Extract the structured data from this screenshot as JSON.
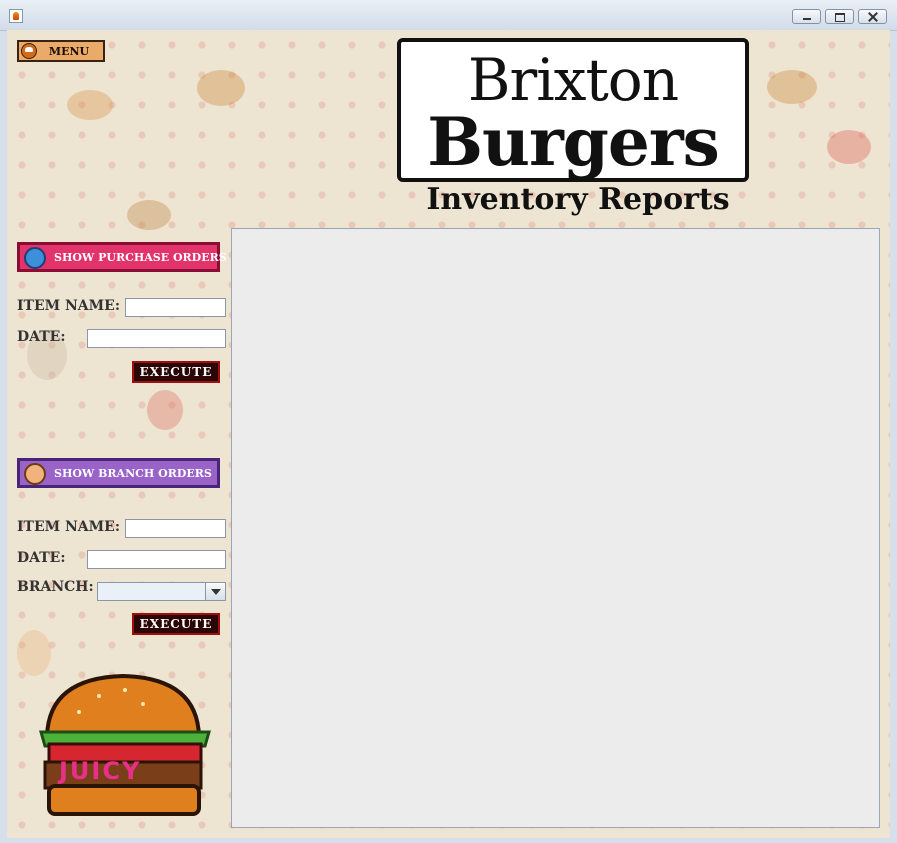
{
  "window": {
    "title": ""
  },
  "top_menu": {
    "label": "MENU"
  },
  "logo": {
    "line1": "Brixton",
    "line2": "Burgers"
  },
  "page_subtitle": "Inventory Reports",
  "purchase_orders": {
    "button_label": "SHOW PURCHASE ORDERS",
    "item_name_label": "ITEM NAME:",
    "item_name_value": "",
    "date_label": "DATE:",
    "date_value": "",
    "execute_label": "EXECUTE"
  },
  "branch_orders": {
    "button_label": "SHOW BRANCH ORDERS",
    "item_name_label": "ITEM NAME:",
    "item_name_value": "",
    "date_label": "DATE:",
    "date_value": "",
    "branch_label": "BRANCH:",
    "branch_value": "",
    "execute_label": "EXECUTE"
  },
  "mascot": {
    "text": "JUICY",
    "icon": "juicy-burger-icon"
  },
  "colors": {
    "purchase_button": "#e2346a",
    "branch_button": "#9a63c8",
    "execute_button": "#2a0606",
    "menu_button": "#e9aa6a",
    "background": "#eee4d2"
  }
}
